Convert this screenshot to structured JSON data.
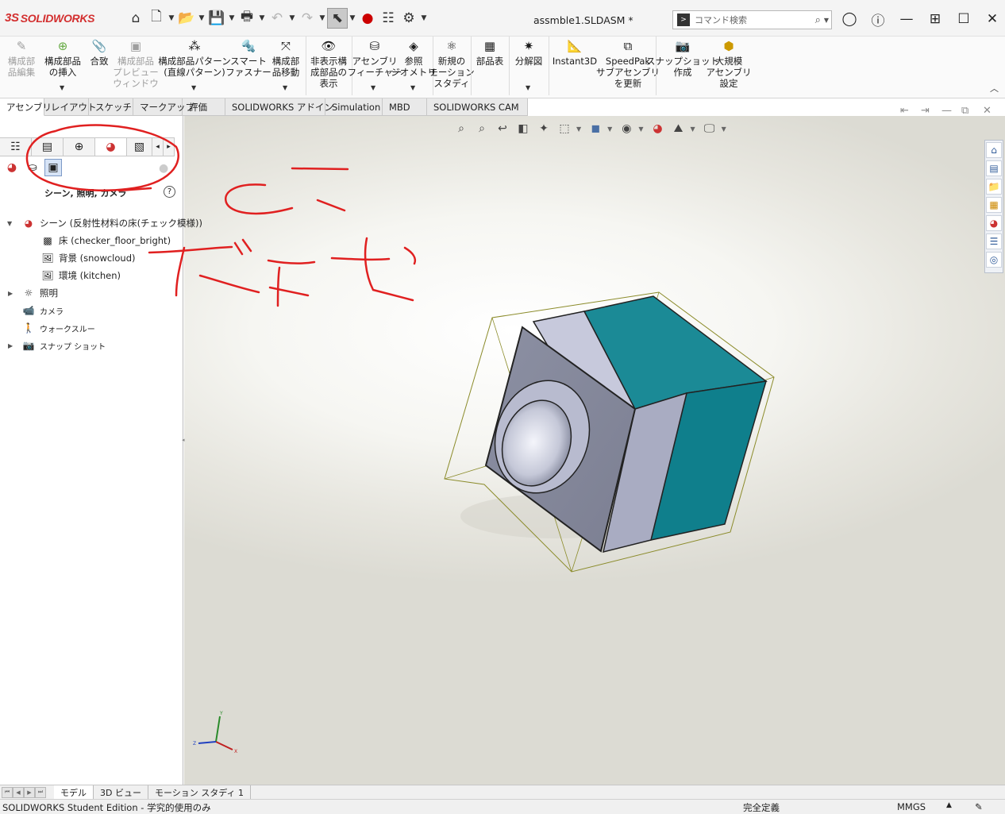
{
  "app": {
    "brand_ds": "3S",
    "brand": "SOLIDWORKS",
    "document_title": "assmble1.SLDASM *"
  },
  "search": {
    "placeholder": "コマンド検索"
  },
  "ribbon": {
    "buttons": [
      {
        "label": "構成部\n品編集",
        "icon": "edit-component-icon",
        "enabled": false
      },
      {
        "label": "構成部品\nの挿入",
        "icon": "insert-component-icon",
        "enabled": true
      },
      {
        "label": "合致",
        "icon": "mate-icon",
        "enabled": true
      },
      {
        "label": "構成部品\nプレビュー\nウィンドウ",
        "icon": "preview-window-icon",
        "enabled": false
      },
      {
        "label": "構成部品パターン\n(直線パターン)",
        "icon": "linear-pattern-icon",
        "enabled": true
      },
      {
        "label": "スマート\nファスナー",
        "icon": "smart-fastener-icon",
        "enabled": true
      },
      {
        "label": "構成部\n品移動",
        "icon": "move-component-icon",
        "enabled": true
      },
      {
        "label": "非表示構\n成部品の\n表示",
        "icon": "show-hidden-icon",
        "enabled": true
      },
      {
        "label": "アセンブリ\nフィーチャー",
        "icon": "assembly-feature-icon",
        "enabled": true
      },
      {
        "label": "参照\nジオメトリ",
        "icon": "reference-geometry-icon",
        "enabled": true
      },
      {
        "label": "新規の\nモーション\nスタディ",
        "icon": "motion-study-icon",
        "enabled": true
      },
      {
        "label": "部品表",
        "icon": "bom-icon",
        "enabled": true
      },
      {
        "label": "分解図",
        "icon": "exploded-view-icon",
        "enabled": true
      },
      {
        "label": "Instant3D",
        "icon": "instant3d-icon",
        "enabled": true
      },
      {
        "label": "SpeedPak\nサブアセンブリ\nを更新",
        "icon": "speedpak-icon",
        "enabled": true
      },
      {
        "label": "スナップショット\n作成",
        "icon": "snapshot-icon",
        "enabled": true
      },
      {
        "label": "大規模\nアセンブリ\n設定",
        "icon": "large-assembly-icon",
        "enabled": true
      }
    ]
  },
  "tabs": [
    "アセンブリ",
    "レイアウト",
    "スケッチ",
    "マークアップ",
    "評価",
    "SOLIDWORKS アドイン",
    "Simulation",
    "MBD",
    "SOLIDWORKS CAM"
  ],
  "left_panel": {
    "title": "シーン, 照明, カメラ",
    "help": "?",
    "tree": [
      {
        "label": "シーン (反射性材料の床(チェック模様))",
        "icon": "scene-icon",
        "level": 0,
        "expandable": true,
        "expanded": true
      },
      {
        "label": "床 (checker_floor_bright)",
        "icon": "floor-icon",
        "level": 1,
        "expandable": false
      },
      {
        "label": "背景 (snowcloud)",
        "icon": "background-icon",
        "level": 1,
        "expandable": false
      },
      {
        "label": "環境 (kitchen)",
        "icon": "environment-icon",
        "level": 1,
        "expandable": false
      },
      {
        "label": "照明",
        "icon": "lights-icon",
        "level": 0,
        "expandable": true,
        "expanded": false
      },
      {
        "label": "カメラ",
        "icon": "camera-icon",
        "level": 0,
        "expandable": false
      },
      {
        "label": "ウォークスルー",
        "icon": "walkthrough-icon",
        "level": 0,
        "expandable": false
      },
      {
        "label": "スナップ ショット",
        "icon": "snapshot-folder-icon",
        "level": 0,
        "expandable": true,
        "expanded": false
      }
    ]
  },
  "triad": {
    "x": "X",
    "y": "Y",
    "z": "Z"
  },
  "bottom_tabs": [
    "モデル",
    "3D ビュー",
    "モーション スタディ 1"
  ],
  "status": {
    "left": "SOLIDWORKS Student Edition - 学究的使用のみ",
    "state": "完全定義",
    "units": "MMGS"
  },
  "colors": {
    "accent_red": "#d32f2f",
    "part_gray": "#9a9eb8",
    "part_teal": "#0f7f8c",
    "annotation_red": "#e02020"
  }
}
